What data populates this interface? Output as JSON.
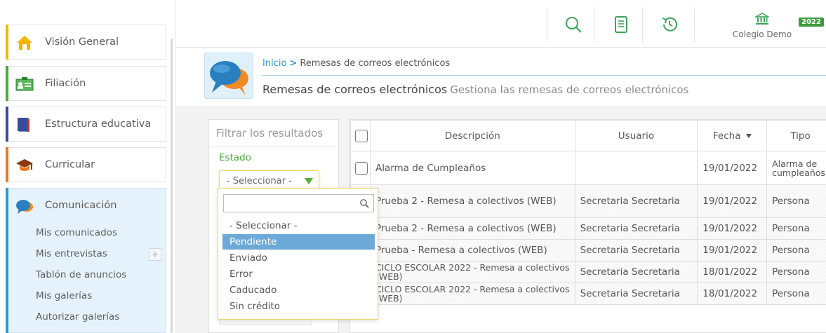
{
  "sidebar": {
    "items": [
      {
        "label": "Visión General",
        "color": "#f2b705"
      },
      {
        "label": "Filiación",
        "color": "#4caa3c"
      },
      {
        "label": "Estructura educativa",
        "color": "#3a4a9e"
      },
      {
        "label": "Curricular",
        "color": "#ee7a21"
      },
      {
        "label": "Comunicación",
        "color": "#2a9bd4"
      }
    ],
    "comunicacion_sub": [
      "Mis comunicados",
      "Mis entrevistas",
      "Tablón de anuncios",
      "Mis galerías",
      "Autorizar galerías"
    ],
    "plus": "+"
  },
  "topbar": {
    "school_name": "Colegio Demo",
    "year": "2022"
  },
  "breadcrumb": {
    "home": "Inicio",
    "separator": ">",
    "current": "Remesas de correos electrónicos"
  },
  "page": {
    "title": "Remesas de correos electrónicos",
    "subtitle": "Gestiona las remesas de correos electrónicos"
  },
  "filter": {
    "title": "Filtrar los resultados",
    "estado_label": "Estado",
    "estado_value": "- Seleccionar -"
  },
  "dropdown": {
    "search_value": "",
    "options": [
      "- Seleccionar -",
      "Pendiente",
      "Enviado",
      "Error",
      "Caducado",
      "Sin crédito"
    ],
    "highlighted": "Pendiente"
  },
  "table": {
    "headers": {
      "descripcion": "Descripción",
      "usuario": "Usuario",
      "fecha": "Fecha",
      "tipo": "Tipo"
    },
    "rows": [
      {
        "descripcion": "Alarma de Cumpleaños",
        "usuario": "",
        "fecha": "19/01/2022",
        "tipo": "Alarma de cumpleaños"
      },
      {
        "descripcion": "Prueba 2 - Remesa a colectivos (WEB)",
        "usuario": "Secretaria Secretaria",
        "fecha": "19/01/2022",
        "tipo": "Persona"
      },
      {
        "descripcion": "Prueba 2 - Remesa a colectivos (WEB)",
        "usuario": "Secretaria Secretaria",
        "fecha": "19/01/2022",
        "tipo": "Persona"
      },
      {
        "descripcion": "Prueba - Remesa a colectivos (WEB)",
        "usuario": "Secretaria Secretaria",
        "fecha": "19/01/2022",
        "tipo": "Persona"
      },
      {
        "descripcion": "CICLO ESCOLAR 2022 - Remesa a colectivos (WEB)",
        "usuario": "Secretaria Secretaria",
        "fecha": "18/01/2022",
        "tipo": "Persona"
      },
      {
        "descripcion": "CICLO ESCOLAR 2022 - Remesa a colectivos (WEB)",
        "usuario": "Secretaria Secretaria",
        "fecha": "18/01/2022",
        "tipo": "Persona"
      }
    ]
  },
  "icons": {
    "search": "search-icon",
    "document": "document-icon",
    "history": "history-icon",
    "school": "school-building-icon"
  },
  "colors": {
    "accent": "#2a9bd4",
    "green": "#4caa3c",
    "highlight": "#6da9d8"
  }
}
